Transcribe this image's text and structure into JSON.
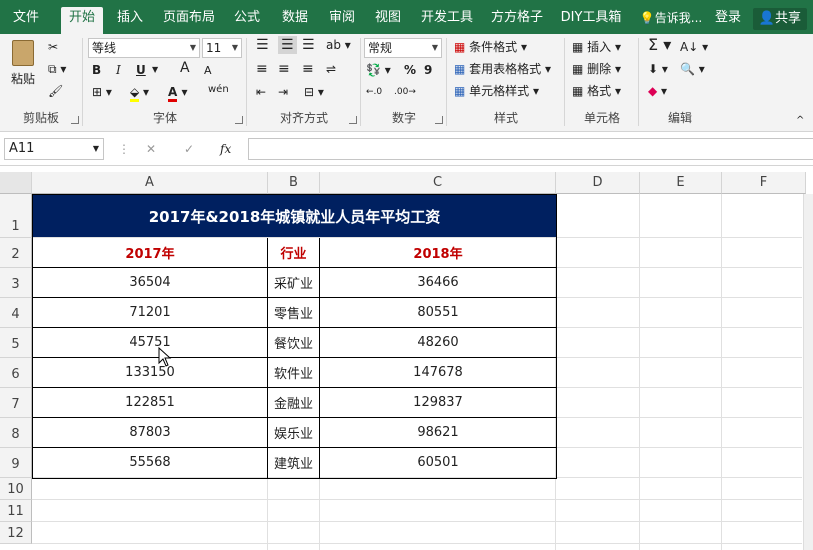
{
  "ribbon_tabs": [
    "文件",
    "开始",
    "插入",
    "页面布局",
    "公式",
    "数据",
    "审阅",
    "视图",
    "开发工具",
    "方方格子",
    "DIY工具箱"
  ],
  "tell_me": "告诉我...",
  "login": "登录",
  "share": "共享",
  "clipboard": {
    "paste": "粘贴",
    "label": "剪贴板"
  },
  "font": {
    "name": "等线",
    "size": "11",
    "bold": "B",
    "italic": "I",
    "underline": "U",
    "grow": "A",
    "shrink": "A",
    "wen": "wén",
    "label": "字体"
  },
  "alignment": {
    "label": "对齐方式"
  },
  "number": {
    "format": "常规",
    "percent": "%",
    "comma": "9",
    "label": "数字"
  },
  "styles": {
    "cond": "条件格式",
    "table": "套用表格格式",
    "cell": "单元格样式",
    "label": "样式"
  },
  "cells": {
    "insert": "插入",
    "delete": "删除",
    "format": "格式",
    "label": "单元格"
  },
  "editing": {
    "label": "编辑"
  },
  "formula_bar": {
    "name_box": "A11",
    "cancel": "✕",
    "enter": "✓",
    "fx": "fx",
    "value": ""
  },
  "columns": [
    "A",
    "B",
    "C",
    "D",
    "E",
    "F"
  ],
  "rows": [
    "1",
    "2",
    "3",
    "4",
    "5",
    "6",
    "7",
    "8",
    "9",
    "10",
    "11",
    "12"
  ],
  "sheet": {
    "title": "2017年&2018年城镇就业人员年平均工资",
    "headers": [
      "2017年",
      "行业",
      "2018年"
    ],
    "data": [
      [
        "36504",
        "采矿业",
        "36466"
      ],
      [
        "71201",
        "零售业",
        "80551"
      ],
      [
        "45751",
        "餐饮业",
        "48260"
      ],
      [
        "133150",
        "软件业",
        "147678"
      ],
      [
        "122851",
        "金融业",
        "129837"
      ],
      [
        "87803",
        "娱乐业",
        "98621"
      ],
      [
        "55568",
        "建筑业",
        "60501"
      ]
    ]
  },
  "colors": {
    "accent": "#217346",
    "title_bg": "#002060",
    "header_text": "#c00000"
  }
}
